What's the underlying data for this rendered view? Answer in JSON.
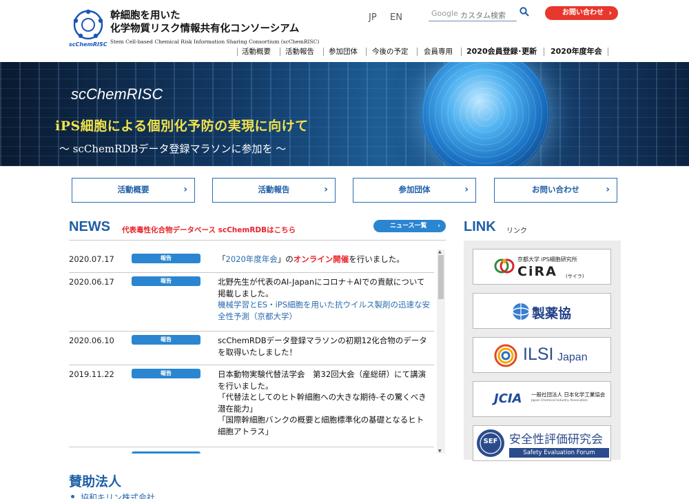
{
  "header": {
    "logo_text": "scChemRISC",
    "title_line1": "幹細胞を用いた",
    "title_line2": "化学物質リスク情報共有化コンソーシアム",
    "title_en": "Stem Cell-based Chemical Risk Information Sharing Consortium (scChemRISC)",
    "lang": [
      "JP",
      "EN"
    ],
    "search_placeholder": "カスタム検索",
    "search_brand": "Google",
    "contact_label": "お問い合わせ"
  },
  "nav": {
    "items": [
      "活動概要",
      "活動報告",
      "参加団体",
      "今後の予定",
      "会員専用",
      "2020会員登録･更新",
      "2020年度年会"
    ]
  },
  "hero": {
    "brand": "scChemRISC",
    "headline": "iPS細胞による個別化予防の実現に向けて",
    "subline": "～ scChemRDBデータ登録マラソンに参加を ～"
  },
  "quick_links": [
    "活動概要",
    "活動報告",
    "参加団体",
    "お問い合わせ"
  ],
  "news": {
    "title": "NEWS",
    "db_link": "代表毒性化合物データベース scChemRDBはこちら",
    "all_label": "ニュース一覧",
    "items": [
      {
        "date": "2020.07.17",
        "tag": "報告",
        "text_before": "「",
        "link": "2020年度年会",
        "text_mid": "」の",
        "red": "オンライン開催",
        "text_after": "を行いました。"
      },
      {
        "date": "2020.06.17",
        "tag": "報告",
        "text": "北野先生が代表のAI-Japanにコロナ＋AIでの貢献について掲載しました。",
        "link": "機械学習とES・iPS細胞を用いた抗ウイルス製剤の迅速な安全性予測（京都大学）"
      },
      {
        "date": "2020.06.10",
        "tag": "報告",
        "text": "scChemRDBデータ登録マラソンの初期12化合物のデータを取得いたしました！"
      },
      {
        "date": "2019.11.22",
        "tag": "報告",
        "text": "日本動物実験代替法学会　第32回大会（産総研）にて講演を行いました。",
        "quote1": "「代替法としてのヒト幹細胞への大きな期待-その驚くべき潜在能力」",
        "quote2": "「国際幹細胞バンクの概要と細胞標準化の基礎となるヒト細胞アトラス」"
      }
    ]
  },
  "link_panel": {
    "title": "LINK",
    "subtitle": "リンク",
    "cira": {
      "top": "京都大学  iPS細胞研究所",
      "name": "CiRA",
      "kana": "(サイラ)"
    },
    "seiyaku": "製薬協",
    "ilsi": {
      "name": "ILSI",
      "suffix": "Japan"
    },
    "jcia": {
      "name": "JCIA",
      "org": "一般社団法人 日本化学工業協会",
      "en": "Japan Chemical Industry Association"
    },
    "sef": {
      "name": "安全性評価研究会",
      "en": "Safety Evaluation Forum",
      "mark": "SEF"
    }
  },
  "sponsors": {
    "title": "賛助法人",
    "items": [
      "協和キリン株式会社"
    ]
  },
  "colors": {
    "accent": "#1e5ea6",
    "contact": "#e8372c",
    "tag": "#2a86d0",
    "alert": "#e8242a",
    "hero_headline": "#f2e34a"
  }
}
